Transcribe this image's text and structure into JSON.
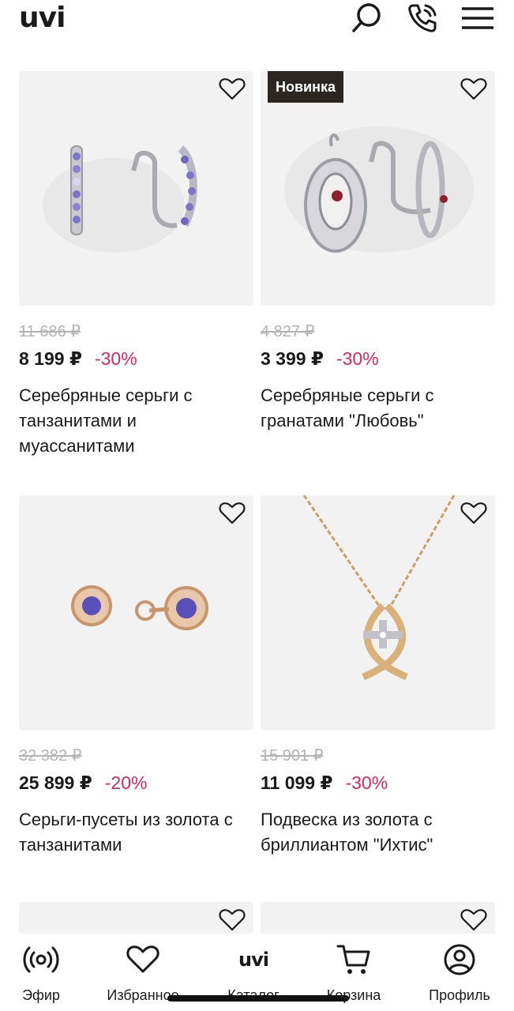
{
  "header": {
    "logo": "uvi",
    "search_icon": "search-icon",
    "phone_icon": "phone-icon",
    "menu_icon": "menu-icon"
  },
  "products": [
    {
      "old_price": "11 686 ₽",
      "price": "8 199 ₽",
      "discount": "-30%",
      "title": "Серебряные серьги с танзанитами и муассанитами",
      "badge": ""
    },
    {
      "old_price": "4 827 ₽",
      "price": "3 399 ₽",
      "discount": "-30%",
      "title": "Серебряные серьги с гранатами \"Любовь\"",
      "badge": "Новинка"
    },
    {
      "old_price": "32 382 ₽",
      "price": "25 899 ₽",
      "discount": "-20%",
      "title": "Серьги-пусеты из золота с танзанитами",
      "badge": ""
    },
    {
      "old_price": "15 901 ₽",
      "price": "11 099 ₽",
      "discount": "-30%",
      "title": "Подвеска из золота с бриллиантом \"Ихтис\"",
      "badge": ""
    }
  ],
  "bottom_nav": {
    "items": [
      {
        "label": "Эфир",
        "icon": "broadcast-icon"
      },
      {
        "label": "Избранное",
        "icon": "heart-icon"
      },
      {
        "label": "Каталог",
        "icon": "uvi-logo-icon",
        "logo": "uvi"
      },
      {
        "label": "Корзина",
        "icon": "cart-icon"
      },
      {
        "label": "Профиль",
        "icon": "profile-icon"
      }
    ]
  },
  "colors": {
    "discount": "#e0245e",
    "old_price": "#b3b3b3",
    "badge_bg": "#2b2621",
    "card_bg": "#f2f2f2"
  }
}
